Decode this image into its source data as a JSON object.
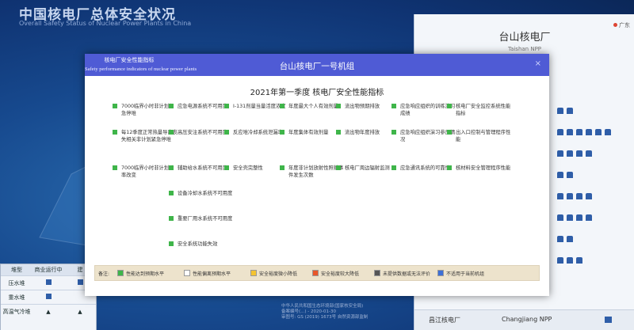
{
  "background": {
    "title": "中国核电厂总体安全状况",
    "subtitle": "Overall Safety Status of Nuclear Power Plants in China",
    "plant_panel": {
      "title": "台山核电厂",
      "subtitle": "Taishan NPP",
      "tag": "广东"
    },
    "left_table": {
      "headers": [
        "堆型",
        "商业运行中",
        "建"
      ],
      "rows": [
        {
          "label": "压水堆"
        },
        {
          "label": "重水堆"
        },
        {
          "label": "高温气冷堆",
          "marks": [
            "▲",
            "▲"
          ]
        }
      ]
    },
    "bottom_row": {
      "name": "昌江核电厂",
      "en": "Changjiang NPP"
    },
    "footer_lines": [
      "中华人民共和国生态环境部(国家核安全局)",
      "备案编号(...) - 2020-01-30",
      "审图号: GS (2019) 1673号 自然资源部监制"
    ]
  },
  "modal": {
    "tab_cn": "核电厂安全性能指标",
    "tab_en": "Safety performance indicators of nuclear power plants",
    "title": "台山核电厂一号机组",
    "close": "×",
    "body_title": "2021年第一季度 核电厂安全性能指标",
    "indicators": [
      {
        "text": "7000临界小时非计划紧急停堆",
        "status": "green"
      },
      {
        "text": "每12季度正常热量导出丧失相关非计划紧急停堆",
        "status": "green"
      },
      {
        "text": "7000临界小时非计划功率改变",
        "status": "green"
      },
      {
        "text": "应急电源系统不可用度",
        "status": "green"
      },
      {
        "text": "高压安注系统不可用度",
        "status": "green"
      },
      {
        "text": "辅助给水系统不可用度",
        "status": "green"
      },
      {
        "text": "设备冷却水系统不可用度",
        "status": "green"
      },
      {
        "text": "重要厂用水系统不可用度",
        "status": "green"
      },
      {
        "text": "安全系统功能失效",
        "status": "green"
      },
      {
        "text": "I-131剂量当量活度浓度",
        "status": "green"
      },
      {
        "text": "反应堆冷却系统泄漏率",
        "status": "green"
      },
      {
        "text": "安全壳完整性",
        "status": "green"
      },
      {
        "text": "年度最大个人有效剂量",
        "status": "green"
      },
      {
        "text": "年度集体有效剂量",
        "status": "green"
      },
      {
        "text": "年度非计划放射性照射事件发生次数",
        "status": "green"
      },
      {
        "text": "流出物预期排放",
        "status": "green"
      },
      {
        "text": "流出物年度排放",
        "status": "green"
      },
      {
        "text": "核电厂周边辐射监测",
        "status": "green"
      },
      {
        "text": "应急响应组织的训练演习成绩",
        "status": "green"
      },
      {
        "text": "应急响应组织演习参加情况",
        "status": "green"
      },
      {
        "text": "应急通讯系统的可靠性",
        "status": "green"
      },
      {
        "text": "核电厂安全监控系统性能指标",
        "status": "green"
      },
      {
        "text": "出入口控制与管理程序性能",
        "status": "green"
      },
      {
        "text": "核材料安全管理程序性能",
        "status": "green"
      }
    ],
    "legend": {
      "label": "备注:",
      "items": [
        {
          "text": "性能达到预期水平",
          "color": "#3fb54a"
        },
        {
          "text": "性能偏离预期水平",
          "color": "#ffffff"
        },
        {
          "text": "安全裕度微小降低",
          "color": "#f4c431"
        },
        {
          "text": "安全裕度较大降低",
          "color": "#e8572a"
        },
        {
          "text": "未提供数据或无法评价",
          "color": "#555555"
        },
        {
          "text": "不适用于当前机组",
          "color": "#3d6fd6"
        }
      ]
    }
  }
}
